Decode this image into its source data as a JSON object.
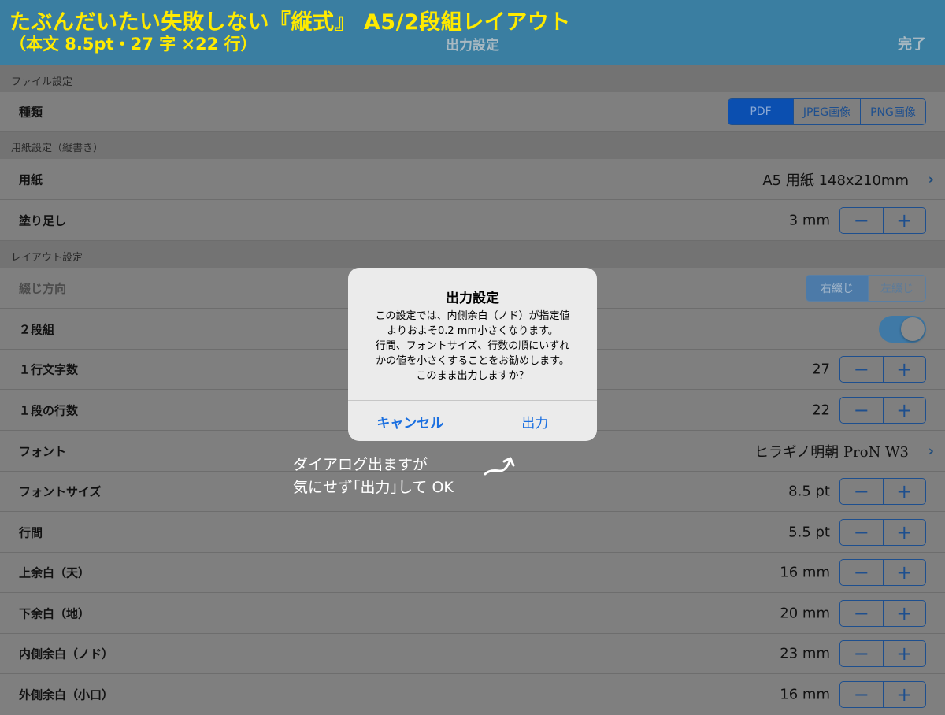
{
  "header": {
    "title_line1": "たぶんだいたい失敗しない『縦式』 A5/2段組レイアウト",
    "title_line2": "（本文 8.5pt・27 字 ×22 行）",
    "nav_title": "出力設定",
    "done_label": "完了"
  },
  "sections": {
    "file": "ファイル設定",
    "paper": "用紙設定（縦書き）",
    "layout": "レイアウト設定"
  },
  "file_type": {
    "label": "種類",
    "options": [
      "PDF",
      "JPEG画像",
      "PNG画像"
    ],
    "selected": "PDF"
  },
  "paper": {
    "label": "用紙",
    "value": "A5 用紙 148x210mm"
  },
  "bleed": {
    "label": "塗り足し",
    "value": "3 mm"
  },
  "binding": {
    "label": "綴じ方向",
    "options": [
      "右綴じ",
      "左綴じ"
    ],
    "selected": "右綴じ"
  },
  "two_column": {
    "label": "２段組",
    "on": true
  },
  "rows": {
    "chars_per_line": {
      "label": "１行文字数",
      "value": "27"
    },
    "lines_per_column": {
      "label": "１段の行数",
      "value": "22"
    },
    "font": {
      "label": "フォント",
      "value": "ヒラギノ明朝 ProN W3"
    },
    "font_size": {
      "label": "フォントサイズ",
      "value": "8.5 pt"
    },
    "line_spacing": {
      "label": "行間",
      "value": "5.5 pt"
    },
    "margin_top": {
      "label": "上余白（天）",
      "value": "16 mm"
    },
    "margin_bottom": {
      "label": "下余白（地）",
      "value": "20 mm"
    },
    "margin_inner": {
      "label": "内側余白（ノド）",
      "value": "23 mm"
    },
    "margin_outer": {
      "label": "外側余白（小口）",
      "value": "16 mm"
    }
  },
  "stepper": {
    "minus": "−",
    "plus": "+"
  },
  "dialog": {
    "title": "出力設定",
    "message_lines": [
      "この設定では、内側余白（ノド）が指定値",
      "よりおよそ0.2 mm小さくなります。",
      "行間、フォントサイズ、行数の順にいずれ",
      "かの値を小さくすることをお勧めします。",
      "このまま出力しますか？"
    ],
    "cancel_label": "キャンセル",
    "confirm_label": "出力"
  },
  "annotation": {
    "line1": "ダイアログ出ますが",
    "line2": "気にせず｢出力｣して OK"
  },
  "colors": {
    "header_bg": "#3a7ea1",
    "title_yellow": "#ffea00",
    "accent_blue": "#1e4f8e",
    "dialog_button_blue": "#1a6fe0"
  }
}
